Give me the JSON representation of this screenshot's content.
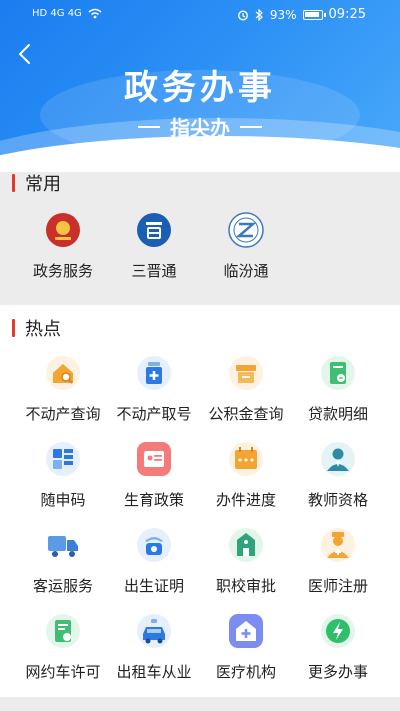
{
  "status_bar": {
    "network": "HD 4G 4G",
    "battery": "93%",
    "time": "09:25"
  },
  "header": {
    "title": "政务办事",
    "subtitle": "指尖办"
  },
  "common": {
    "title": "常用",
    "items": [
      {
        "label": "政务服务",
        "icon": "government-emblem-icon"
      },
      {
        "label": "三晋通",
        "icon": "sanjintong-logo-icon"
      },
      {
        "label": "临汾通",
        "icon": "linfentong-logo-icon"
      }
    ]
  },
  "hot": {
    "title": "热点",
    "items": [
      {
        "label": "不动产查询",
        "icon": "house-search-icon"
      },
      {
        "label": "不动产取号",
        "icon": "medicine-bottle-icon"
      },
      {
        "label": "公积金查询",
        "icon": "fund-box-icon"
      },
      {
        "label": "贷款明细",
        "icon": "loan-document-icon"
      },
      {
        "label": "随申码",
        "icon": "qr-code-icon"
      },
      {
        "label": "生育政策",
        "icon": "id-card-icon"
      },
      {
        "label": "办件进度",
        "icon": "calendar-icon"
      },
      {
        "label": "教师资格",
        "icon": "teacher-icon"
      },
      {
        "label": "客运服务",
        "icon": "truck-icon"
      },
      {
        "label": "出生证明",
        "icon": "baby-icon"
      },
      {
        "label": "职校审批",
        "icon": "school-building-icon"
      },
      {
        "label": "医师注册",
        "icon": "doctor-icon"
      },
      {
        "label": "网约车许可",
        "icon": "permit-document-icon"
      },
      {
        "label": "出租车从业",
        "icon": "taxi-icon"
      },
      {
        "label": "医疗机构",
        "icon": "hospital-icon"
      },
      {
        "label": "更多办事",
        "icon": "lightning-icon"
      }
    ]
  }
}
